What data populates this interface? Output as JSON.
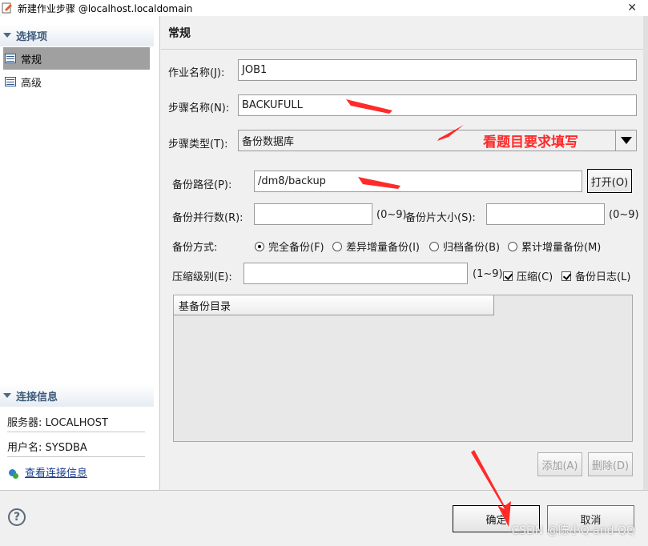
{
  "window": {
    "title": "新建作业步骤 @localhost.localdomain",
    "close_glyph": "✕"
  },
  "left": {
    "options_header": "选择项",
    "nav_items": [
      {
        "label": "常规",
        "selected": true
      },
      {
        "label": "高级",
        "selected": false
      }
    ],
    "conn_header": "连接信息",
    "server": "服务器: LOCALHOST",
    "user": "用户名: SYSDBA",
    "view_conn_link": "查看连接信息"
  },
  "right": {
    "section_title": "常规",
    "job_name_label": "作业名称(J):",
    "job_name_value": "JOB1",
    "step_name_label": "步骤名称(N):",
    "step_name_value": "BACKUFULL",
    "step_type_label": "步骤类型(T):",
    "step_type_value": "备份数据库",
    "backup_path_label": "备份路径(P):",
    "backup_path_value": "/dm8/backup",
    "open_button": "打开(O)",
    "parallel_label": "备份并行数(R):",
    "parallel_value": "",
    "parallel_range": "(0~9)",
    "piece_size_label": "备份片大小(S):",
    "piece_size_value": "",
    "piece_size_range": "(0~9)",
    "backup_mode_label": "备份方式:",
    "backup_modes": [
      {
        "label": "完全备份(F)",
        "checked": true
      },
      {
        "label": "差异增量备份(I)",
        "checked": false
      },
      {
        "label": "归档备份(B)",
        "checked": false
      },
      {
        "label": "累计增量备份(M)",
        "checked": false
      }
    ],
    "compress_level_label": "压缩级别(E):",
    "compress_level_value": "",
    "compress_range": "(1~9)",
    "compress_check": {
      "label": "压缩(C)",
      "checked": true
    },
    "backup_log_check": {
      "label": "备份日志(L)",
      "checked": true
    },
    "base_dir_column": "基备份目录",
    "add_button": "添加(A)",
    "delete_button": "删除(D)"
  },
  "footer": {
    "help_glyph": "?",
    "ok_button": "确定",
    "cancel_button": "取消"
  },
  "annotations": {
    "note": "看题目要求填写",
    "watermark": "CSDN @陈小Q and QQ",
    "color": "#ff2a2a"
  }
}
